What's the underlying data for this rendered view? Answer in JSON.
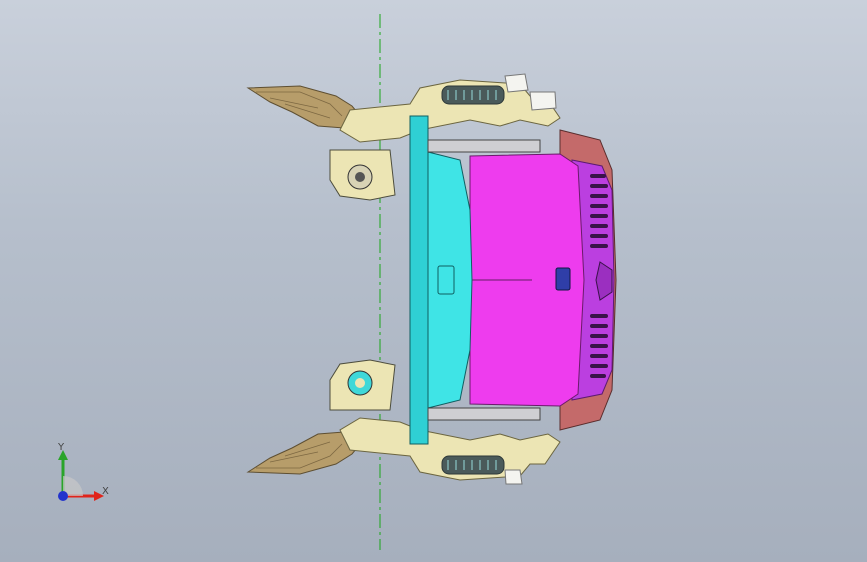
{
  "viewport": {
    "background_top": "#c9d0db",
    "background_bottom": "#a6afbd"
  },
  "triad": {
    "x_label": "X",
    "y_label": "Y",
    "x_color": "#e0241b",
    "y_color": "#2aa42a",
    "z_color": "#2233cc"
  },
  "model": {
    "colors": {
      "bracket": "#ece5b4",
      "foam": "#b79d6a",
      "foam_dark": "#7d6842",
      "panel": "#3fe4e6",
      "cover": "#ee3cee",
      "grille": "#bb3fe0",
      "bumper": "#c46a6a",
      "accent_cyan": "#13c2c8",
      "centerline": "#1aa61a"
    }
  }
}
